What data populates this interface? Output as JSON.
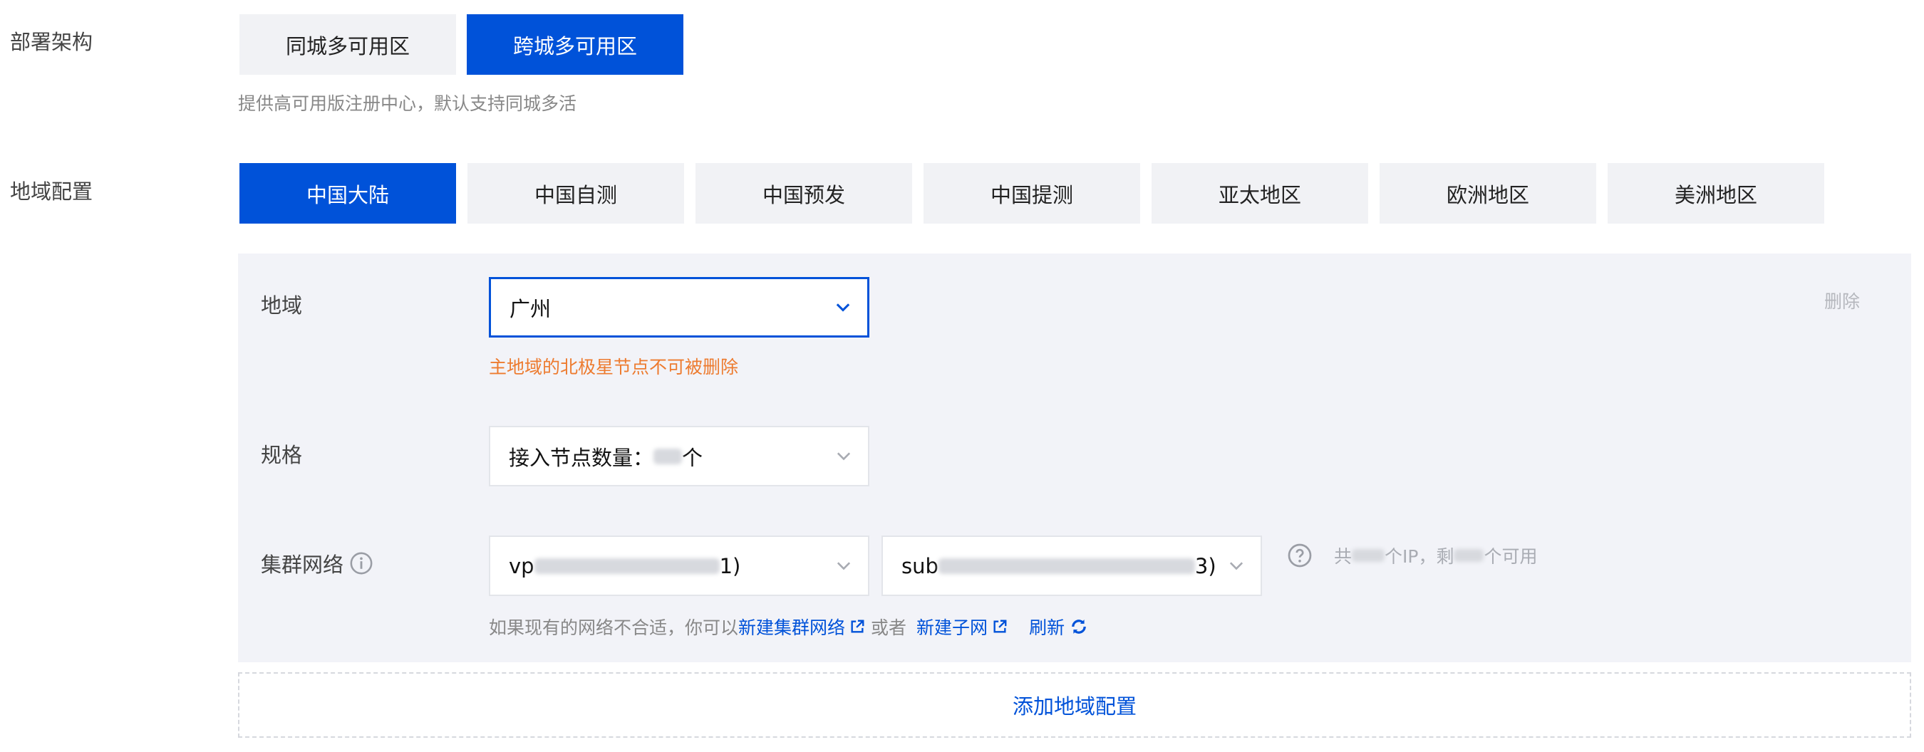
{
  "deploy": {
    "label": "部署架构",
    "options": [
      "同城多可用区",
      "跨城多可用区"
    ],
    "active_index": 1,
    "hint": "提供高可用版注册中心，默认支持同城多活"
  },
  "region_config": {
    "label": "地域配置",
    "tabs": [
      "中国大陆",
      "中国自测",
      "中国预发",
      "中国提测",
      "亚太地区",
      "欧洲地区",
      "美洲地区"
    ],
    "active_index": 0
  },
  "panel": {
    "region_label": "地域",
    "region_value": "广州",
    "delete_label": "删除",
    "region_warning": "主地域的北极星节点不可被删除",
    "spec_label": "规格",
    "spec_prefix": "接入节点数量：",
    "spec_suffix": "个",
    "network_label": "集群网络",
    "vpc_prefix": "vp",
    "vpc_suffix": "1)",
    "subnet_prefix": "sub",
    "subnet_suffix": "3)",
    "ip_text_1": "共",
    "ip_text_2": "个IP，剩",
    "ip_text_3": "个可用",
    "help_text": "如果现有的网络不合适，你可以",
    "new_cluster_network": "新建集群网络",
    "or_text": "或者",
    "new_subnet": "新建子网",
    "refresh": "刷新"
  },
  "add_region_config": "添加地域配置",
  "colors": {
    "primary": "#0052d9",
    "warning": "#ed7b2f",
    "panel_bg": "#f2f3f8",
    "segment_bg": "#f1f2f5"
  },
  "icons": [
    "chevron-down-icon",
    "info-icon",
    "help-circle-icon",
    "external-link-icon",
    "refresh-icon"
  ]
}
